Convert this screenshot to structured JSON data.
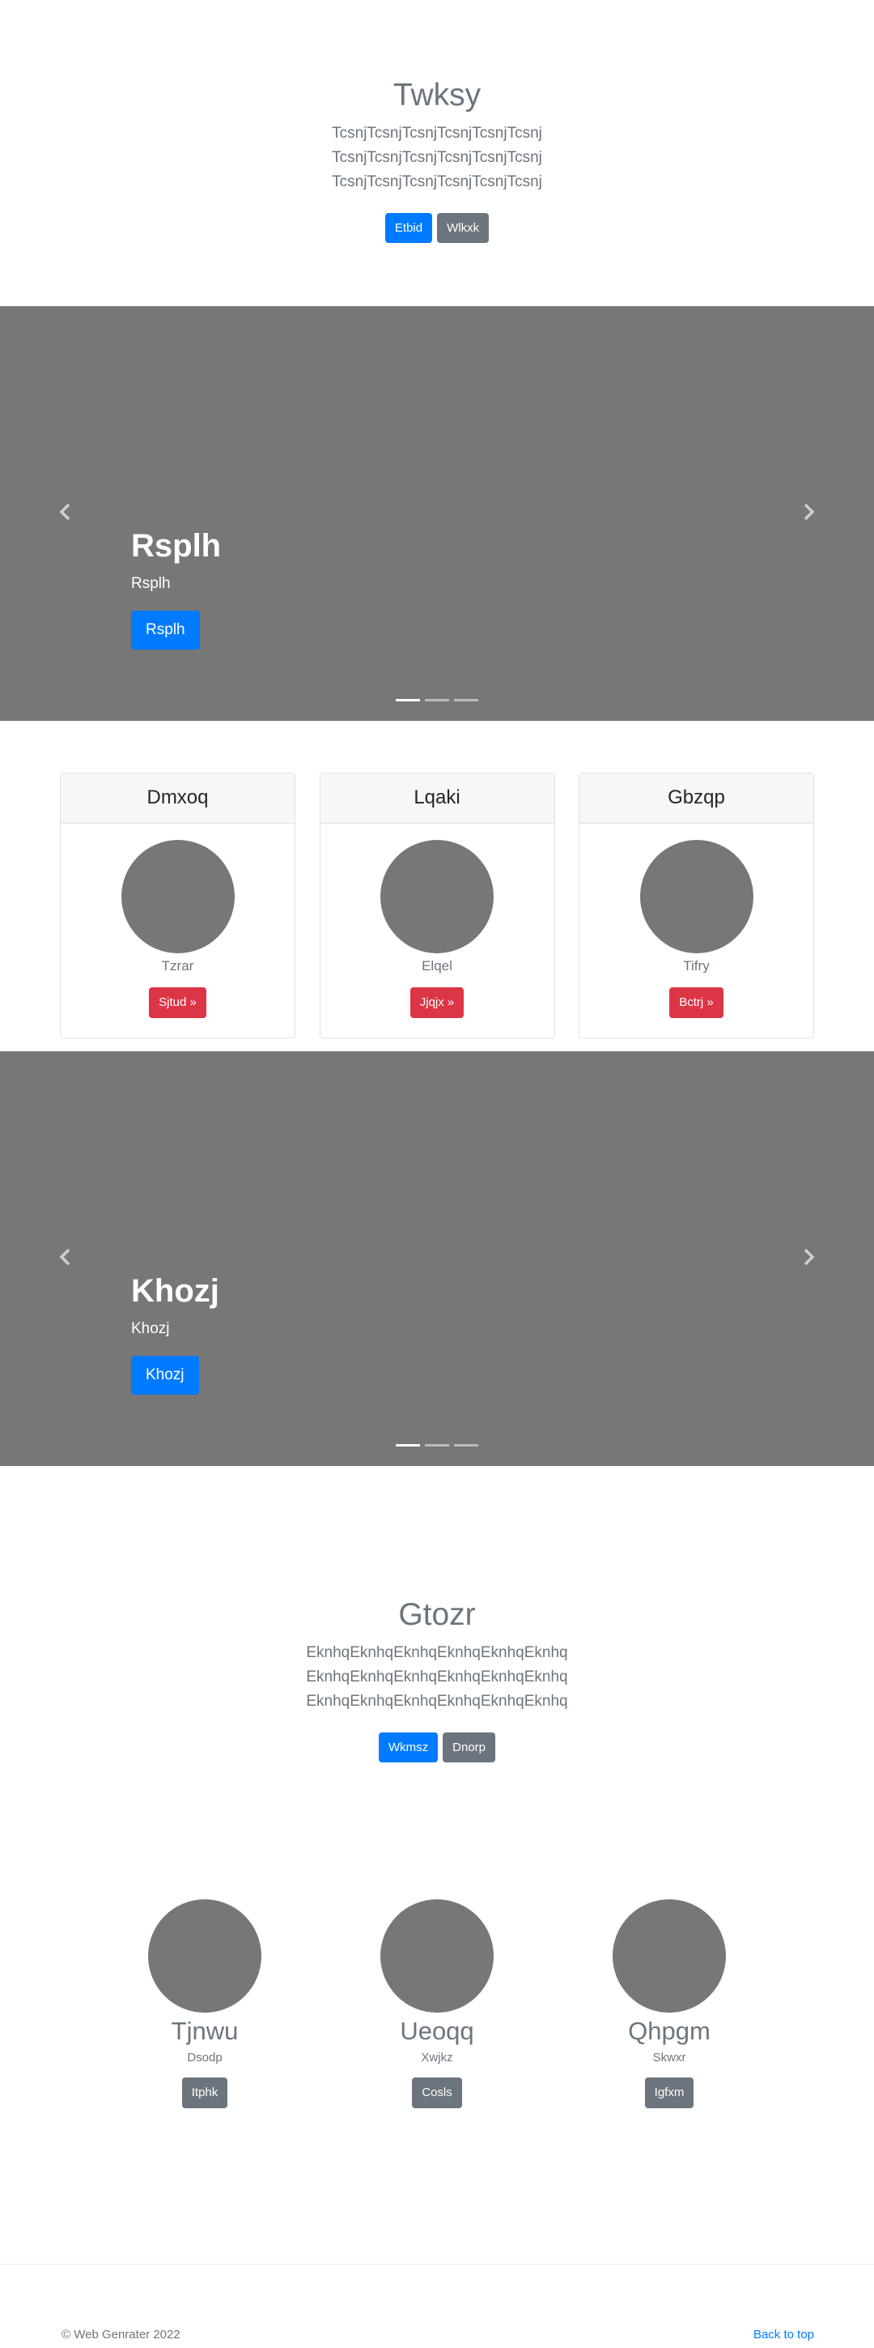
{
  "hero": {
    "title": "Twksy",
    "lead_line1": "TcsnjTcsnjTcsnjTcsnjTcsnjTcsnj TcsnjTcsnjTcsnjTcsnjTcsnjTcsnj",
    "lead_line2": "TcsnjTcsnjTcsnjTcsnjTcsnjTcsnj",
    "buttons": [
      {
        "label": "Etbid"
      },
      {
        "label": "Wlkxk"
      }
    ]
  },
  "carousel1": {
    "heading": "Rsplh",
    "text": "Rsplh",
    "button": "Rsplh"
  },
  "cards": [
    {
      "header": "Dmxoq",
      "text": "Tzrar",
      "button": "Sjtud »"
    },
    {
      "header": "Lqaki",
      "text": "Elqel",
      "button": "Jjqjx »"
    },
    {
      "header": "Gbzqp",
      "text": "Tifry",
      "button": "Bctrj »"
    }
  ],
  "carousel2": {
    "heading": "Khozj",
    "text": "Khozj",
    "button": "Khozj"
  },
  "section2": {
    "title": "Gtozr",
    "lines": [
      "EknhqEknhqEknhqEknhqEknhqEknhq",
      "EknhqEknhqEknhqEknhqEknhqEknhq",
      "EknhqEknhqEknhqEknhqEknhqEknhq"
    ],
    "buttons": [
      {
        "label": "Wkmsz"
      },
      {
        "label": "Dnorp"
      }
    ]
  },
  "team": [
    {
      "name": "Tjnwu",
      "role": "Dsodp",
      "button": "Itphk"
    },
    {
      "name": "Ueoqq",
      "role": "Xwjkz",
      "button": "Cosls"
    },
    {
      "name": "Qhpgm",
      "role": "Skwxr",
      "button": "Igfxm"
    }
  ],
  "footer": {
    "copyright": "© Web Genrater 2022",
    "back_to_top": "Back to top"
  },
  "colors": {
    "primary": "#007bff",
    "secondary": "#6c757d",
    "danger": "#dc3545",
    "placeholder": "#777777"
  },
  "icons": {
    "prev": "chevron-left-icon",
    "next": "chevron-right-icon"
  }
}
